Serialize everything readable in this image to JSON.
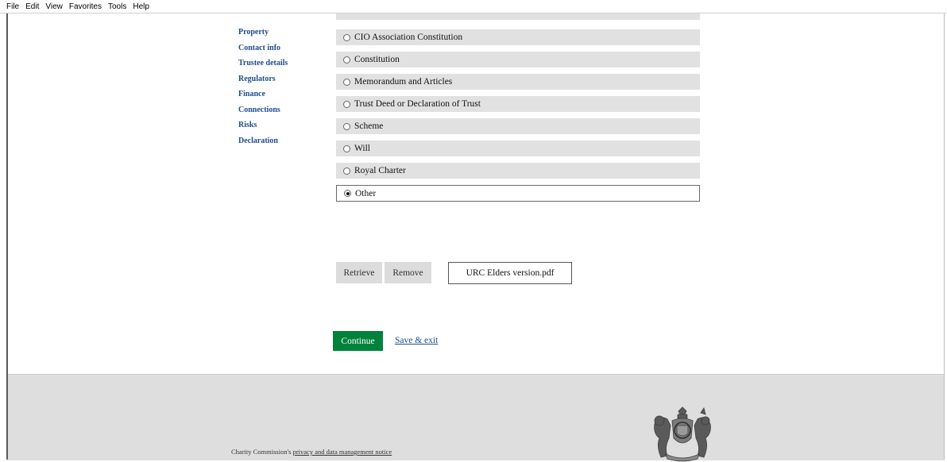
{
  "menubar": {
    "items": [
      "File",
      "Edit",
      "View",
      "Favorites",
      "Tools",
      "Help"
    ]
  },
  "nav": {
    "items": [
      "Property",
      "Contact info",
      "Trustee details",
      "Regulators",
      "Finance",
      "Connections",
      "Risks",
      "Declaration"
    ]
  },
  "governing_document": {
    "options": [
      {
        "label": "CIO Association Constitution",
        "selected": false
      },
      {
        "label": "Constitution",
        "selected": false
      },
      {
        "label": "Memorandum and Articles",
        "selected": false
      },
      {
        "label": "Trust Deed or Declaration of Trust",
        "selected": false
      },
      {
        "label": "Scheme",
        "selected": false
      },
      {
        "label": "Will",
        "selected": false
      },
      {
        "label": "Royal Charter",
        "selected": false
      },
      {
        "label": "Other",
        "selected": true
      }
    ]
  },
  "upload": {
    "retrieve_label": "Retrieve",
    "remove_label": "Remove",
    "file_name": "URC Elders version.pdf"
  },
  "actions": {
    "continue_label": "Continue",
    "save_exit_label": "Save & exit"
  },
  "footer": {
    "prefix": "Charity Commission's ",
    "privacy_link": "privacy and data management notice",
    "crest_icon": "royal-coat-of-arms-icon"
  },
  "colors": {
    "link": "#1d4b8f",
    "continue_bg": "#00823b",
    "option_bg": "#e1e1e1",
    "footer_bg": "#dedede"
  }
}
